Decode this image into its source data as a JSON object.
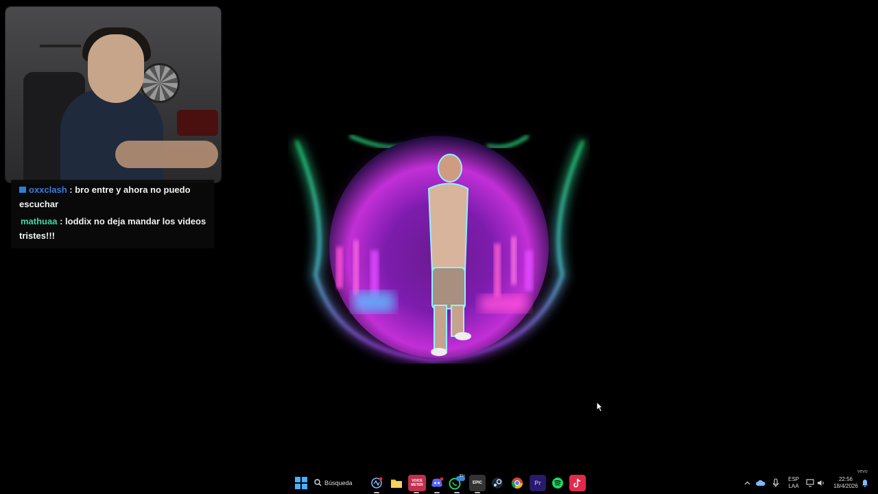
{
  "chat": {
    "messages": [
      {
        "user": "oxxclash",
        "text": ": bro entre y ahora no puedo escuchar"
      },
      {
        "user": "mathuaa",
        "text": ": loddix no deja mandar los videos tristes!!!"
      }
    ]
  },
  "taskbar": {
    "search_label": "Búsqueda",
    "apps": [
      {
        "name": "voice-app-icon",
        "color": "#7fb8ff"
      },
      {
        "name": "file-explorer-icon",
        "color": "#f3c242"
      },
      {
        "name": "voicemeeter-icon",
        "label": "VOICE METER",
        "color": "#c0304e"
      },
      {
        "name": "discord-icon",
        "color": "#5865f2",
        "badge": ""
      },
      {
        "name": "whatsapp-icon",
        "color": "#25d366",
        "badge": "99+"
      },
      {
        "name": "epic-games-icon",
        "label": "EPIC",
        "color": "#333"
      },
      {
        "name": "steam-icon",
        "color": "#1b2838"
      },
      {
        "name": "chrome-icon",
        "color": "#4285f4"
      },
      {
        "name": "premiere-icon",
        "label": "Pr",
        "color": "#2a1a6a"
      },
      {
        "name": "spotify-icon",
        "color": "#1ed760"
      },
      {
        "name": "tiktok-icon",
        "color": "#e3294b"
      }
    ],
    "tray": {
      "language_top": "ESP",
      "language_bottom": "LAA",
      "time": "22:56",
      "date": "18/4/2026",
      "watermark": "vevo"
    }
  },
  "colors": {
    "viz_green": "#29f58a",
    "viz_purple": "#b33cff",
    "viz_cyan": "#5cf2ff",
    "background": "#000000"
  }
}
